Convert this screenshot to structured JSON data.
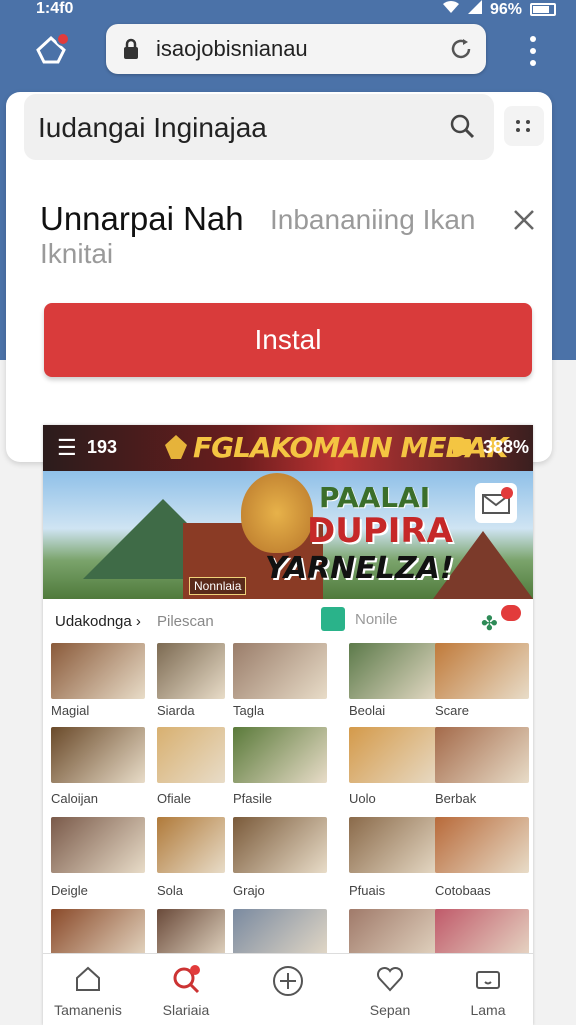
{
  "status": {
    "time": "1:4f0",
    "battery": "96%"
  },
  "browser": {
    "url": "isaojobisnianau"
  },
  "search": {
    "query": "Iudangai Inginajaa"
  },
  "banner": {
    "title": "Unnarpai Nah",
    "subtitle": "Inbananiing Ikan",
    "subtitle_line2": "Iknitai",
    "install_label": "Instal"
  },
  "app": {
    "header_count": "193",
    "brand": "FGLAKOMAIN MEBAK",
    "header_percent": "388%",
    "hero": {
      "line1": "PAALAI",
      "line2": "DUPIRA",
      "line3": "YARNELZA!",
      "tag": "Nonnlaia"
    },
    "categories": {
      "first": "Udakodnga ›",
      "second": "Pilescan",
      "third": "Nonile"
    },
    "grid": [
      {
        "label": "Magial",
        "color": "#8a5a3a"
      },
      {
        "label": "Siarda",
        "color": "#7c6a52"
      },
      {
        "label": "Tagla",
        "color": "#9a7d6a"
      },
      {
        "label": "Beolai",
        "color": "#5c7a4a"
      },
      {
        "label": "Scare",
        "color": "#c07a3a"
      },
      {
        "label": "Caloijan",
        "color": "#6a4a2a"
      },
      {
        "label": "Ofiale",
        "color": "#d8b070"
      },
      {
        "label": "Pfasile",
        "color": "#5a7a3a"
      },
      {
        "label": "Uolo",
        "color": "#d49a4a"
      },
      {
        "label": "Berbak",
        "color": "#a46a4a"
      },
      {
        "label": "Deigle",
        "color": "#7a5a4a"
      },
      {
        "label": "Sola",
        "color": "#b07a3a"
      },
      {
        "label": "Grajo",
        "color": "#7a5a3a"
      },
      {
        "label": "Pfuais",
        "color": "#8a6a4a"
      },
      {
        "label": "Cotobaas",
        "color": "#b86a3a"
      },
      {
        "label": "",
        "color": "#8a4a2a"
      },
      {
        "label": "",
        "color": "#6a4a3a"
      },
      {
        "label": "",
        "color": "#7a8aa0"
      },
      {
        "label": "",
        "color": "#a07a6a"
      },
      {
        "label": "",
        "color": "#c05a6a"
      }
    ],
    "nav": [
      "Tamanenis",
      "Slariaia",
      "",
      "Sepan",
      "Lama"
    ]
  }
}
